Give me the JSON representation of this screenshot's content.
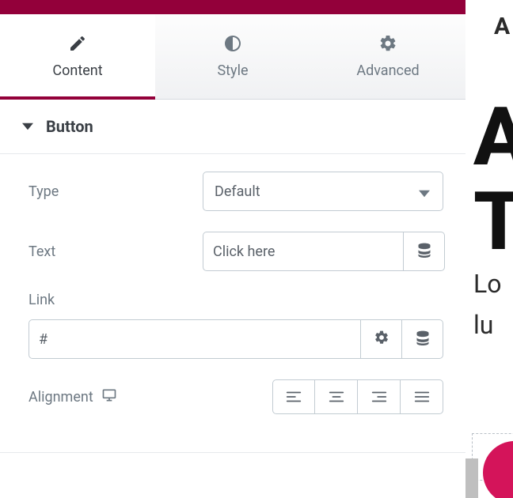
{
  "tabs": {
    "content": "Content",
    "style": "Style",
    "advanced": "Advanced"
  },
  "section": {
    "title": "Button"
  },
  "fields": {
    "type": {
      "label": "Type",
      "value": "Default"
    },
    "text": {
      "label": "Text",
      "value": "Click here"
    },
    "link": {
      "label": "Link",
      "value": "#"
    },
    "alignment": {
      "label": "Alignment"
    }
  },
  "preview": {
    "topletter": "A",
    "heading1": "A",
    "heading2": "T",
    "body1": "Lo",
    "body2": "lu"
  }
}
